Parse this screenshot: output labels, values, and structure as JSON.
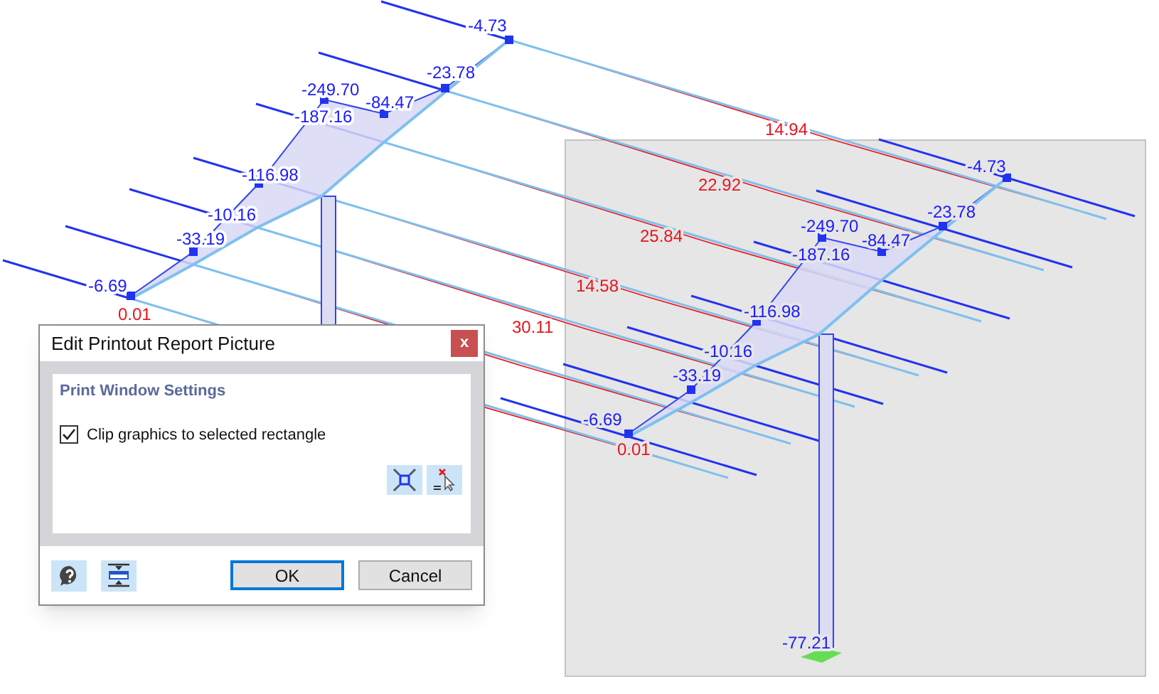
{
  "canvas": {
    "labels": [
      {
        "text": "-4.73",
        "color": "#1a1aff"
      },
      {
        "text": "-23.78",
        "color": "#1a1aff"
      },
      {
        "text": "-249.70",
        "color": "#1a1aff"
      },
      {
        "text": "-84.47",
        "color": "#1a1aff"
      },
      {
        "text": "-187.16",
        "color": "#1a1aff"
      },
      {
        "text": "-116.98",
        "color": "#1a1aff"
      },
      {
        "text": "-10.16",
        "color": "#1a1aff"
      },
      {
        "text": "-33.19",
        "color": "#1a1aff"
      },
      {
        "text": "-6.69",
        "color": "#1a1aff"
      },
      {
        "text": "0.01",
        "color": "#e8141c"
      },
      {
        "text": "14.94",
        "color": "#e8141c"
      },
      {
        "text": "22.92",
        "color": "#e8141c"
      },
      {
        "text": "25.84",
        "color": "#e8141c"
      },
      {
        "text": "14.58",
        "color": "#e8141c"
      },
      {
        "text": "30.11",
        "color": "#e8141c"
      },
      {
        "text": "-4.73",
        "color": "#1a1aff"
      },
      {
        "text": "-23.78",
        "color": "#1a1aff"
      },
      {
        "text": "-249.70",
        "color": "#1a1aff"
      },
      {
        "text": "-84.47",
        "color": "#1a1aff"
      },
      {
        "text": "-187.16",
        "color": "#1a1aff"
      },
      {
        "text": "-116.98",
        "color": "#1a1aff"
      },
      {
        "text": "-10.16",
        "color": "#1a1aff"
      },
      {
        "text": "-33.19",
        "color": "#1a1aff"
      },
      {
        "text": "-6.69",
        "color": "#1a1aff"
      },
      {
        "text": "0.01",
        "color": "#e8141c"
      },
      {
        "text": "-77.21",
        "color": "#1a1aff"
      }
    ]
  },
  "dialog": {
    "title": "Edit Printout Report Picture",
    "close": "x",
    "group": {
      "title": "Print Window Settings",
      "checkbox": {
        "label": "Clip graphics to selected rectangle",
        "checked": true
      }
    },
    "buttons": [
      {
        "label": "OK",
        "default": true
      },
      {
        "label": "Cancel",
        "default": false
      }
    ]
  }
}
